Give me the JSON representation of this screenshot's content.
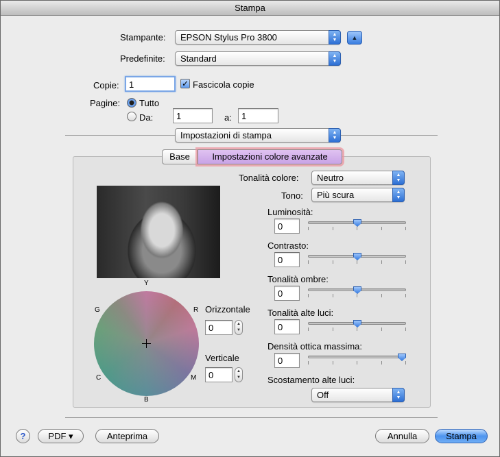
{
  "window": {
    "title": "Stampa"
  },
  "printer": {
    "label": "Stampante:",
    "value": "EPSON Stylus Pro 3800"
  },
  "presets": {
    "label": "Predefinite:",
    "value": "Standard"
  },
  "copies": {
    "label": "Copie:",
    "value": "1",
    "collate_label": "Fascicola copie",
    "collate_checked": true
  },
  "pages": {
    "label": "Pagine:",
    "all_label": "Tutto",
    "from_label": "Da:",
    "to_label": "a:",
    "from_value": "1",
    "to_value": "1",
    "selected": "all"
  },
  "panel_popup": {
    "value": "Impostazioni di stampa"
  },
  "tabs": [
    {
      "label": "Base",
      "selected": false
    },
    {
      "label": "Impostazioni colore avanzate",
      "selected": true
    }
  ],
  "color": {
    "tone_label": "Tonalità colore:",
    "tone_value": "Neutro",
    "tono_label": "Tono:",
    "tono_value": "Più scura",
    "wheel_labels": {
      "top": "Y",
      "left": "G",
      "right": "R",
      "bottom_left": "C",
      "bottom_right": "M",
      "bottom": "B"
    },
    "horizontal_label": "Orizzontale",
    "horizontal_value": "0",
    "vertical_label": "Verticale",
    "vertical_value": "0"
  },
  "sliders": [
    {
      "label": "Luminosità:",
      "value": "0",
      "position": 0.5
    },
    {
      "label": "Contrasto:",
      "value": "0",
      "position": 0.5
    },
    {
      "label": "Tonalità ombre:",
      "value": "0",
      "position": 0.5
    },
    {
      "label": "Tonalità alte luci:",
      "value": "0",
      "position": 0.5
    },
    {
      "label": "Densità ottica massima:",
      "value": "0",
      "position": 1.0
    }
  ],
  "highlight_shift": {
    "label": "Scostamento alte luci:",
    "value": "Off"
  },
  "footer": {
    "help_label": "?",
    "pdf_label": "PDF ▾",
    "preview_label": "Anteprima",
    "cancel_label": "Annulla",
    "print_label": "Stampa"
  },
  "icons": {
    "popup_arrows": "up-down-arrows-icon",
    "collapse": "triangle-up-icon",
    "checkmark": "checkmark-icon"
  }
}
